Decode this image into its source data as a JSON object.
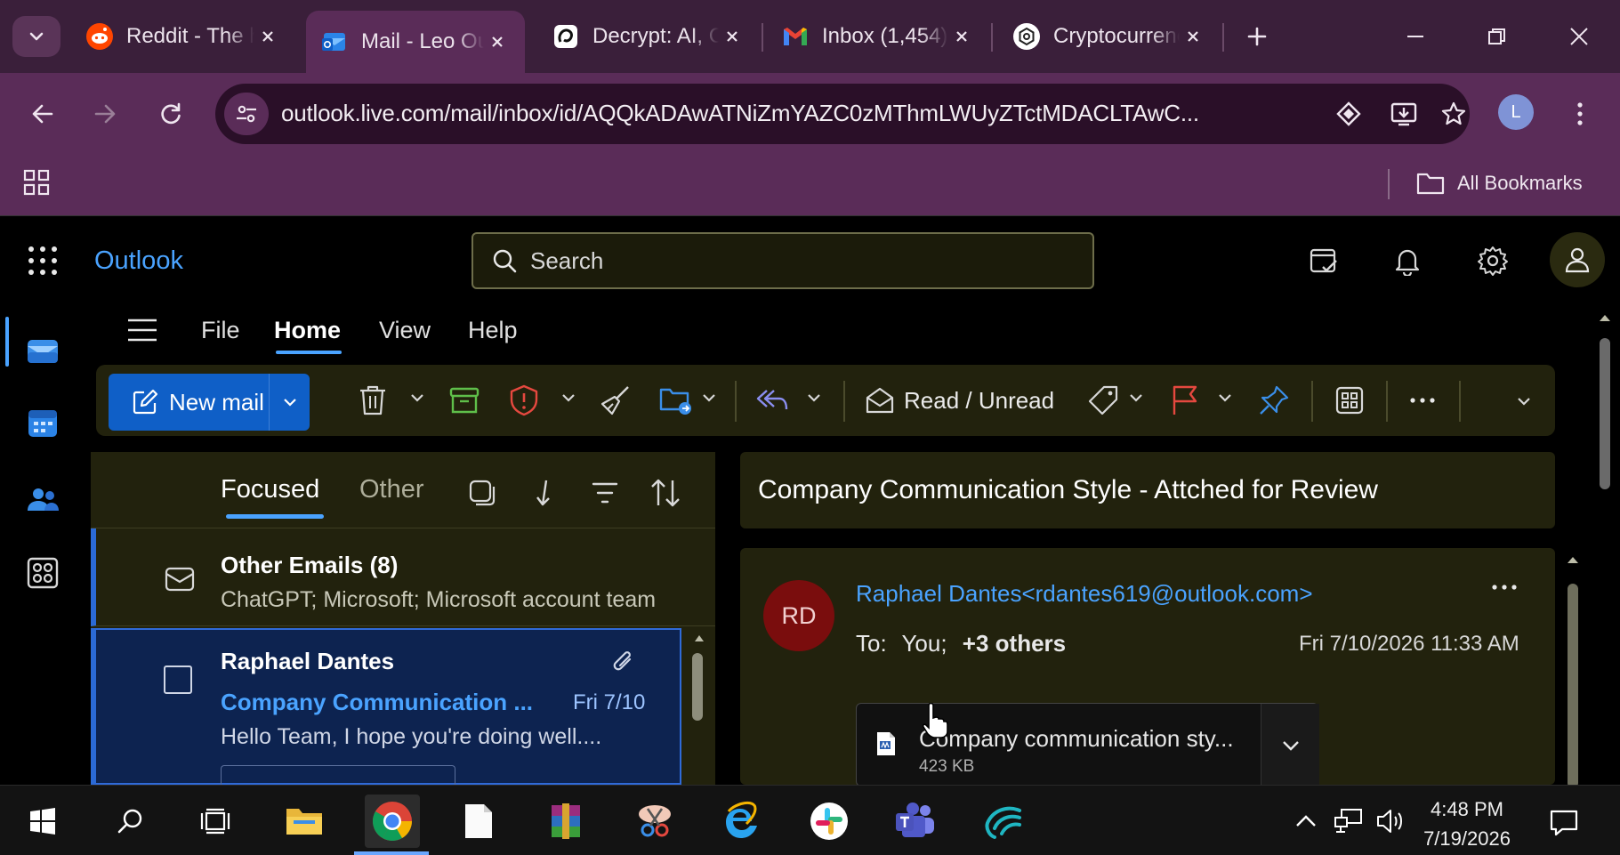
{
  "browser": {
    "tabs": [
      {
        "title": "Reddit - The heart of the internet",
        "icon": "reddit-icon"
      },
      {
        "title": "Mail - Leo Outlook",
        "icon": "outlook-icon",
        "active": true
      },
      {
        "title": "Decrypt: AI, Crypto",
        "icon": "decrypt-icon"
      },
      {
        "title": "Inbox (1,454)",
        "icon": "gmail-icon"
      },
      {
        "title": "Cryptocurrency",
        "icon": "chatgpt-icon"
      }
    ],
    "url": "outlook.live.com/mail/inbox/id/AQQkADAwATNiZmYAZC0zMThmLWUyZTctMDACLTAwC...",
    "profile_initial": "L",
    "bookmarks_label": "All Bookmarks"
  },
  "outlook": {
    "brand": "Outlook",
    "search_placeholder": "Search",
    "menu": {
      "file": "File",
      "home": "Home",
      "view": "View",
      "help": "Help"
    },
    "ribbon": {
      "new_mail": "New mail",
      "read_unread": "Read / Unread"
    },
    "list_tabs": {
      "focused": "Focused",
      "other": "Other"
    },
    "group_row": {
      "title": "Other Emails (8)",
      "senders": "ChatGPT; Microsoft; Microsoft account team"
    },
    "selected_message": {
      "sender": "Raphael Dantes",
      "subject": "Company Communication Style - Attched for Review",
      "subject_short": "Company Communication ...",
      "date": "Fri 7/10",
      "preview": "Hello Team, I hope you're doing well...."
    },
    "reading": {
      "subject": "Company Communication Style - Attched for Review",
      "avatar_initials": "RD",
      "from": "Raphael Dantes<rdantes619@outlook.com>",
      "to_label": "To:",
      "to_you": "You;",
      "to_others": "+3 others",
      "sent": "Fri 7/10/2026 11:33 AM",
      "attachment_name": "Company communication sty...",
      "attachment_size": "423 KB"
    }
  },
  "taskbar": {
    "time": "4:48 PM",
    "date": "7/19/2026"
  },
  "colors": {
    "accent": "#4aa3ff",
    "new_mail_bg": "#0f5fc7",
    "chrome_purple": "#5a2c58",
    "ribbon_bg": "#22220d",
    "selected_row": "#0d2350"
  }
}
